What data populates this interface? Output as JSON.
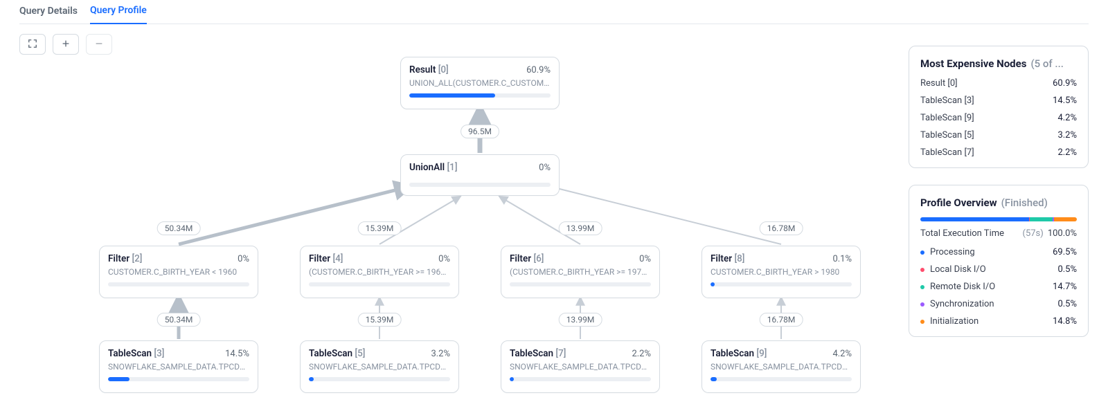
{
  "tabs": {
    "details": "Query Details",
    "profile": "Query Profile",
    "active": "profile"
  },
  "toolbar": {
    "fullscreen": "fullscreen",
    "zoom_in": "zoom-in",
    "zoom_out": "zoom-out"
  },
  "nodes": {
    "result": {
      "title": "Result",
      "idx": "[0]",
      "pct": "60.9%",
      "sub": "UNION_ALL(CUSTOMER.C_CUSTOMER...",
      "fill": 61
    },
    "unionall": {
      "title": "UnionAll",
      "idx": "[1]",
      "pct": "0%",
      "sub": "",
      "fill": 0
    },
    "filter2": {
      "title": "Filter",
      "idx": "[2]",
      "pct": "0%",
      "sub": "CUSTOMER.C_BIRTH_YEAR < 1960",
      "fill": 0
    },
    "filter4": {
      "title": "Filter",
      "idx": "[4]",
      "pct": "0%",
      "sub": "(CUSTOMER.C_BIRTH_YEAR >= 1960) A...",
      "fill": 0
    },
    "filter6": {
      "title": "Filter",
      "idx": "[6]",
      "pct": "0%",
      "sub": "(CUSTOMER.C_BIRTH_YEAR >= 1971) A...",
      "fill": 0
    },
    "filter8": {
      "title": "Filter",
      "idx": "[8]",
      "pct": "0.1%",
      "sub": "CUSTOMER.C_BIRTH_YEAR > 1980",
      "fill": 1.5
    },
    "ts3": {
      "title": "TableScan",
      "idx": "[3]",
      "pct": "14.5%",
      "sub": "SNOWFLAKE_SAMPLE_DATA.TPCDS_SF...",
      "fill": 15
    },
    "ts5": {
      "title": "TableScan",
      "idx": "[5]",
      "pct": "3.2%",
      "sub": "SNOWFLAKE_SAMPLE_DATA.TPCDS_SF...",
      "fill": 3.2
    },
    "ts7": {
      "title": "TableScan",
      "idx": "[7]",
      "pct": "2.2%",
      "sub": "SNOWFLAKE_SAMPLE_DATA.TPCDS_SF...",
      "fill": 2.2
    },
    "ts9": {
      "title": "TableScan",
      "idx": "[9]",
      "pct": "4.2%",
      "sub": "SNOWFLAKE_SAMPLE_DATA.TPCDS_SF...",
      "fill": 4.2
    }
  },
  "edge_labels": {
    "result_union": "96.5M",
    "union_f2": "50.34M",
    "union_f4": "15.39M",
    "union_f6": "13.99M",
    "union_f8": "16.78M",
    "f2_ts3": "50.34M",
    "f4_ts5": "15.39M",
    "f6_ts7": "13.99M",
    "f8_ts9": "16.78M"
  },
  "expensive": {
    "title": "Most Expensive Nodes",
    "subtitle": "(5 of ...",
    "rows": [
      {
        "label": "Result [0]",
        "val": "60.9%"
      },
      {
        "label": "TableScan [3]",
        "val": "14.5%"
      },
      {
        "label": "TableScan [9]",
        "val": "4.2%"
      },
      {
        "label": "TableScan [5]",
        "val": "3.2%"
      },
      {
        "label": "TableScan [7]",
        "val": "2.2%"
      }
    ]
  },
  "overview": {
    "title": "Profile Overview",
    "status": "(Finished)",
    "total_label": "Total Execution Time",
    "total_time": "(57s)",
    "total_pct": "100.0%",
    "segments": [
      {
        "label": "Processing",
        "val": "69.5%",
        "color": "#1a6dff",
        "w": 69.5
      },
      {
        "label": "Local Disk I/O",
        "val": "0.5%",
        "color": "#ff4d6d",
        "w": 0.5
      },
      {
        "label": "Remote Disk I/O",
        "val": "14.7%",
        "color": "#1fc9a8",
        "w": 14.7
      },
      {
        "label": "Synchronization",
        "val": "0.5%",
        "color": "#9b5bff",
        "w": 0.5
      },
      {
        "label": "Initialization",
        "val": "14.8%",
        "color": "#ff8c1a",
        "w": 14.8
      }
    ]
  }
}
